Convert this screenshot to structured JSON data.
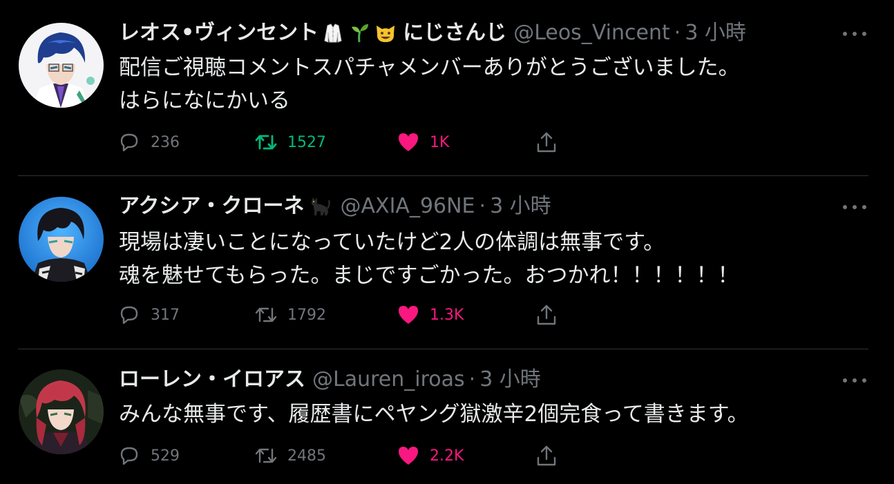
{
  "colors": {
    "background": "#000000",
    "text_primary": "#e7e9ea",
    "text_secondary": "#71767b",
    "divider": "#2f3336",
    "retweet_active": "#00ba7c",
    "like_active": "#f91880"
  },
  "tweets": [
    {
      "display_name": "レオス•ヴィンセント",
      "name_emojis": [
        "lab-coat-emoji",
        "seedling-emoji",
        "grinning-cat-emoji"
      ],
      "name_suffix": "にじさんじ",
      "handle": "@Leos_Vincent",
      "separator": "·",
      "time": "3 小時",
      "text_lines": [
        "配信ご視聴コメントスパチャメンバーありがとうございました。",
        "はらになにかいる"
      ],
      "replies": "236",
      "retweets": "1527",
      "retweeted": true,
      "likes": "1K",
      "liked": true
    },
    {
      "display_name": "アクシア・クローネ",
      "name_emojis": [
        "black-cat-emoji"
      ],
      "handle": "@AXIA_96NE",
      "separator": "·",
      "time": "3 小時",
      "text_lines": [
        "現場は凄いことになっていたけど2人の体調は無事です。",
        "魂を魅せてもらった。まじですごかった。おつかれ！！！！！！"
      ],
      "replies": "317",
      "retweets": "1792",
      "retweeted": false,
      "likes": "1.3K",
      "liked": true
    },
    {
      "display_name": "ローレン・イロアス",
      "name_emojis": [],
      "handle": "@Lauren_iroas",
      "separator": "·",
      "time": "3 小時",
      "text_lines": [
        "みんな無事です、履歴書にペヤング獄激辛2個完食って書きます。"
      ],
      "replies": "529",
      "retweets": "2485",
      "retweeted": false,
      "likes": "2.2K",
      "liked": true
    }
  ]
}
